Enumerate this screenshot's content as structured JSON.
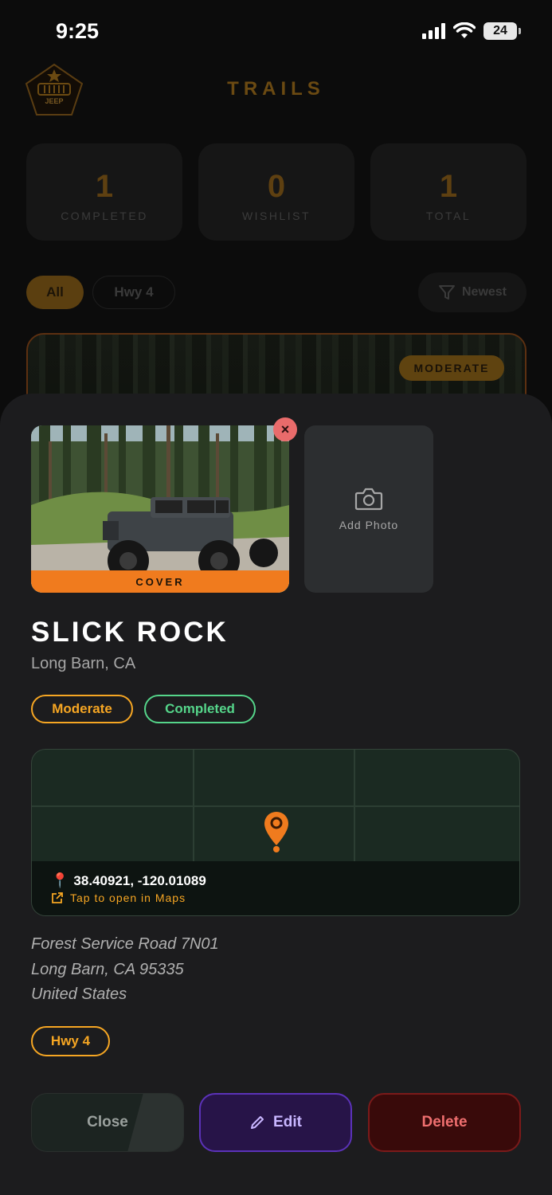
{
  "status": {
    "time": "9:25",
    "battery": "24"
  },
  "background": {
    "title": "TRAILS",
    "logo_text": "JEEP",
    "stats": [
      {
        "value": "1",
        "label": "COMPLETED"
      },
      {
        "value": "0",
        "label": "WISHLIST"
      },
      {
        "value": "1",
        "label": "TOTAL"
      }
    ],
    "filters": {
      "all": "All",
      "hwy4": "Hwy 4"
    },
    "sort_label": "Newest",
    "card_badge": "MODERATE"
  },
  "sheet": {
    "cover_label": "COVER",
    "add_photo_label": "Add Photo",
    "name": "SLICK ROCK",
    "location": "Long Barn, CA",
    "difficulty": "Moderate",
    "status": "Completed",
    "map": {
      "coordinates": "38.40921, -120.01089",
      "open_link": "Tap to open in Maps"
    },
    "address": {
      "line1": "Forest Service Road 7N01",
      "line2": "Long Barn, CA  95335",
      "line3": "United States"
    },
    "route_tag": "Hwy 4",
    "actions": {
      "close": "Close",
      "edit": "Edit",
      "delete": "Delete"
    }
  },
  "colors": {
    "accent": "#f6a623",
    "cover": "#f07b1e",
    "completed": "#55d58a",
    "edit": "#5b32b8",
    "delete": "#ef6f6f",
    "pin": "#f07b1e"
  }
}
